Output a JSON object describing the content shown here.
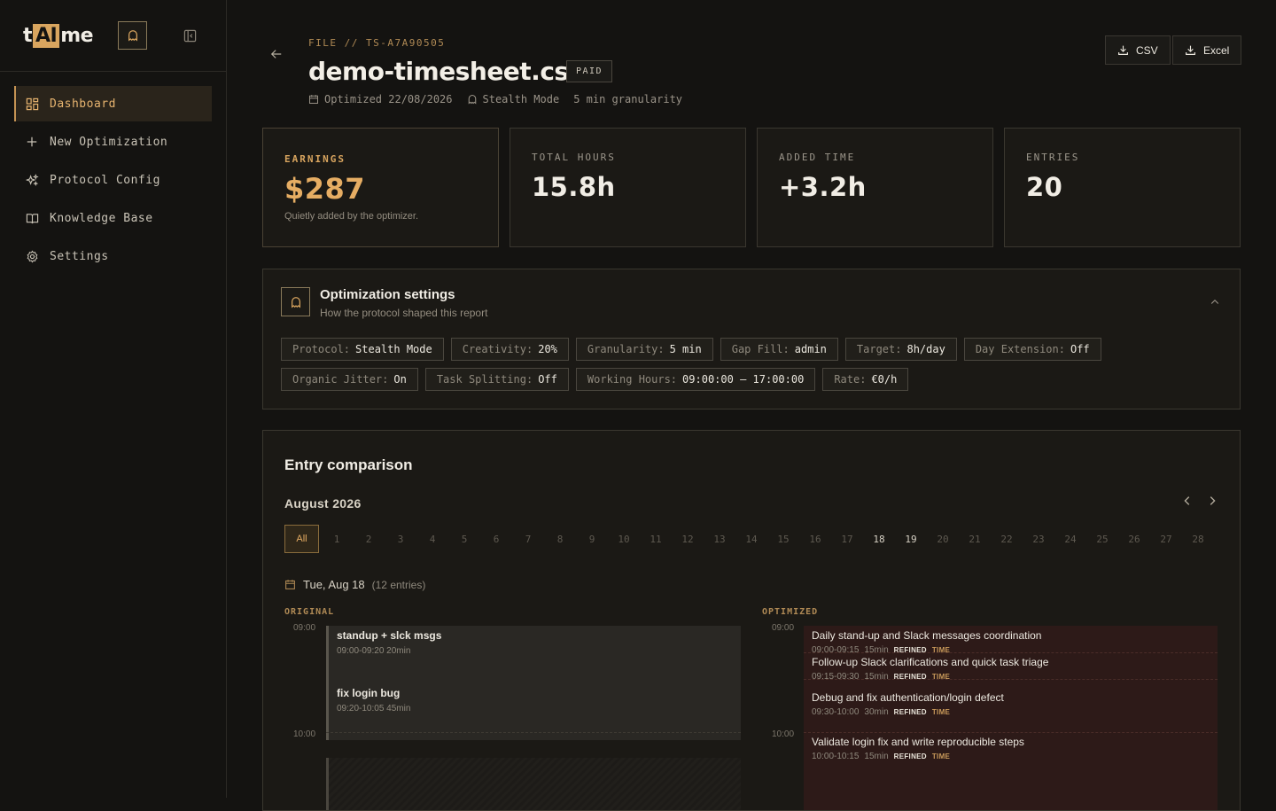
{
  "brand": {
    "logo_pre": "t",
    "logo_ai": "AI",
    "logo_post": "me"
  },
  "sidebar": {
    "items": [
      {
        "label": "Dashboard",
        "icon": "dashboard-icon"
      },
      {
        "label": "New Optimization",
        "icon": "plus-icon"
      },
      {
        "label": "Protocol Config",
        "icon": "sparkles-icon"
      },
      {
        "label": "Knowledge Base",
        "icon": "book-icon"
      },
      {
        "label": "Settings",
        "icon": "gear-icon"
      }
    ]
  },
  "header": {
    "file_label": "FILE // TS-A7A90505",
    "title": "demo-timesheet.csv",
    "status": "PAID",
    "optimized": "Optimized 22/08/2026",
    "protocol": "Stealth Mode",
    "granularity": "5 min granularity",
    "export_csv": "CSV",
    "export_excel": "Excel"
  },
  "stats": {
    "earnings_label": "EARNINGS",
    "earnings_value": "$287",
    "earnings_sub": "Quietly added by the optimizer.",
    "hours_label": "TOTAL HOURS",
    "hours_value": "15.8h",
    "added_label": "ADDED TIME",
    "added_value": "+3.2h",
    "entries_label": "ENTRIES",
    "entries_value": "20"
  },
  "settings": {
    "title": "Optimization settings",
    "desc": "How the protocol shaped this report",
    "pills": [
      {
        "k": "Protocol:",
        "v": "Stealth Mode"
      },
      {
        "k": "Creativity:",
        "v": "20%"
      },
      {
        "k": "Granularity:",
        "v": "5 min"
      },
      {
        "k": "Gap Fill:",
        "v": "admin"
      },
      {
        "k": "Target:",
        "v": "8h/day"
      },
      {
        "k": "Day Extension:",
        "v": "Off"
      },
      {
        "k": "Organic Jitter:",
        "v": "On"
      },
      {
        "k": "Task Splitting:",
        "v": "Off"
      },
      {
        "k": "Working Hours:",
        "v": "09:00:00 – 17:00:00"
      },
      {
        "k": "Rate:",
        "v": "€0/h"
      }
    ]
  },
  "comparison": {
    "title": "Entry comparison",
    "month": "August 2026",
    "all_label": "All",
    "days": [
      "1",
      "2",
      "3",
      "4",
      "5",
      "6",
      "7",
      "8",
      "9",
      "10",
      "11",
      "12",
      "13",
      "14",
      "15",
      "16",
      "17",
      "18",
      "19",
      "20",
      "21",
      "22",
      "23",
      "24",
      "25",
      "26",
      "27",
      "28"
    ],
    "days_with_entries": [
      "18",
      "19"
    ],
    "day_title": "Tue, Aug 18",
    "day_count": "(12 entries)",
    "original_label": "ORIGINAL",
    "optimized_label": "OPTIMIZED",
    "time_0900": "09:00",
    "time_1000": "10:00",
    "original": [
      {
        "title": "standup + slck msgs",
        "meta": "09:00-09:20  20min"
      },
      {
        "title": "fix login bug",
        "meta": "09:20-10:05  45min"
      }
    ],
    "optimized": [
      {
        "title": "Daily stand-up and Slack messages coordination",
        "time": "09:00-09:15",
        "dur": "15min",
        "tag1": "REFINED",
        "tag2": "TIME"
      },
      {
        "title": "Follow-up Slack clarifications and quick task triage",
        "time": "09:15-09:30",
        "dur": "15min",
        "tag1": "REFINED",
        "tag2": "TIME"
      },
      {
        "title": "Debug and fix authentication/login defect",
        "time": "09:30-10:00",
        "dur": "30min",
        "tag1": "REFINED",
        "tag2": "TIME"
      },
      {
        "title": "Validate login fix and write reproducible steps",
        "time": "10:00-10:15",
        "dur": "15min",
        "tag1": "REFINED",
        "tag2": "TIME"
      }
    ]
  }
}
